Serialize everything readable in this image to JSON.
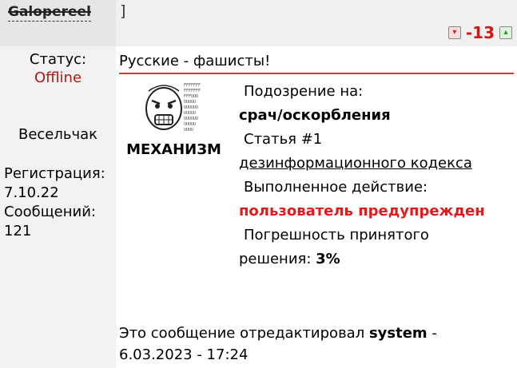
{
  "header": {
    "username": "Galopereel",
    "bracket": "]",
    "rating": "-13",
    "thumb_down_icon": "thumb-down-icon",
    "thumb_up_icon": "thumb-up-icon"
  },
  "profile": {
    "status_label": "Статус:",
    "status_value": "Offline",
    "rank": "Весельчак",
    "registration_label": "Регистрация:",
    "registration_date": "7.10.22",
    "messages_label": "Сообщений:",
    "messages_count": "121"
  },
  "post": {
    "title": "Русские - фашисты!",
    "moderator_name": "МЕХАНИЗМ",
    "suspicion_label": "Подозрение на:",
    "suspicion_value": "срач/оскорбления",
    "article_label": "Статья #1",
    "article_link": "дезинформационного кодекса",
    "action_label": "Выполненное действие:",
    "action_value": "пользователь предупрежден",
    "error_label_line1": "Погрешность принятого",
    "error_label_line2": "решения:",
    "error_value": "3%",
    "edited_prefix": "Это сообщение отредактировал",
    "edited_by": "system",
    "edited_date": "6.03.2023 - 17:24"
  },
  "colors": {
    "rating": "#dd1111",
    "status_offline": "#b01818",
    "action": "#e01b1b",
    "separator": "#dd3333"
  }
}
